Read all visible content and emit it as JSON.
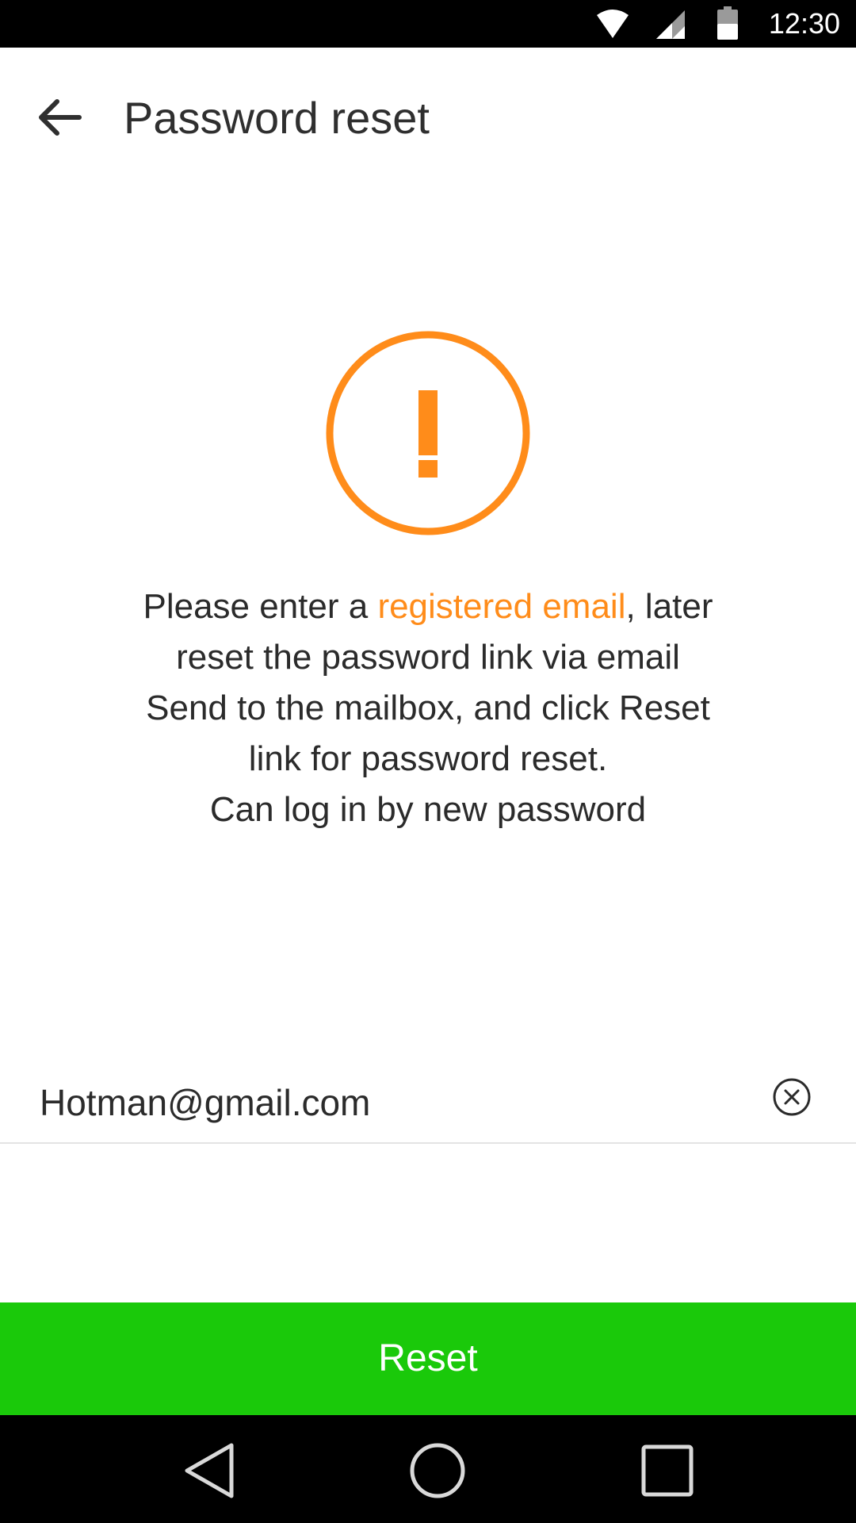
{
  "status_bar": {
    "time": "12:30",
    "icons": [
      "wifi-icon",
      "cell-signal-icon",
      "battery-icon"
    ]
  },
  "app_bar": {
    "title": "Password reset",
    "back_icon": "arrow-left-icon"
  },
  "warning": {
    "icon": "exclamation-circle-icon",
    "color": "#ff8c1a"
  },
  "message": {
    "line1_prefix": "Please enter a ",
    "line1_highlight": "registered email",
    "line1_suffix": ", later",
    "line2": "reset the password link via email",
    "line3": "Send to the mailbox, and click Reset",
    "line4": "link for password reset.",
    "line5": "Can log in by new password"
  },
  "email_field": {
    "value": "Hotman@gmail.com",
    "clear_icon": "clear-circle-icon"
  },
  "reset_button": {
    "label": "Reset",
    "color": "#1ac90a"
  },
  "nav_bar": {
    "icons": [
      "nav-back-icon",
      "nav-home-icon",
      "nav-recents-icon"
    ]
  }
}
